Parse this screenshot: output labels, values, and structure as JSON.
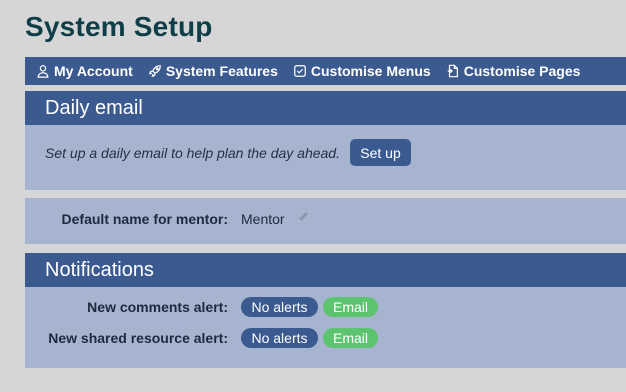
{
  "page": {
    "title": "System Setup"
  },
  "nav": {
    "items": [
      {
        "label": "My Account",
        "icon": "user-icon"
      },
      {
        "label": "System Features",
        "icon": "rocket-icon"
      },
      {
        "label": "Customise Menus",
        "icon": "checkbox-icon"
      },
      {
        "label": "Customise Pages",
        "icon": "page-icon"
      }
    ]
  },
  "daily_email": {
    "title": "Daily email",
    "description": "Set up a daily email to help plan the day ahead.",
    "button": "Set up"
  },
  "mentor": {
    "label": "Default name for mentor:",
    "value": "Mentor",
    "edit_icon": "pencil-icon"
  },
  "notifications": {
    "title": "Notifications",
    "rows": [
      {
        "label": "New comments alert:",
        "options": [
          "No alerts",
          "Email"
        ]
      },
      {
        "label": "New shared resource alert:",
        "options": [
          "No alerts",
          "Email"
        ]
      }
    ]
  },
  "colors": {
    "background": "#d6d6d6",
    "primary": "#3b5a8f",
    "panel": "#a6b4cf",
    "title": "#0e3e47",
    "email_green": "#5cc46f"
  }
}
